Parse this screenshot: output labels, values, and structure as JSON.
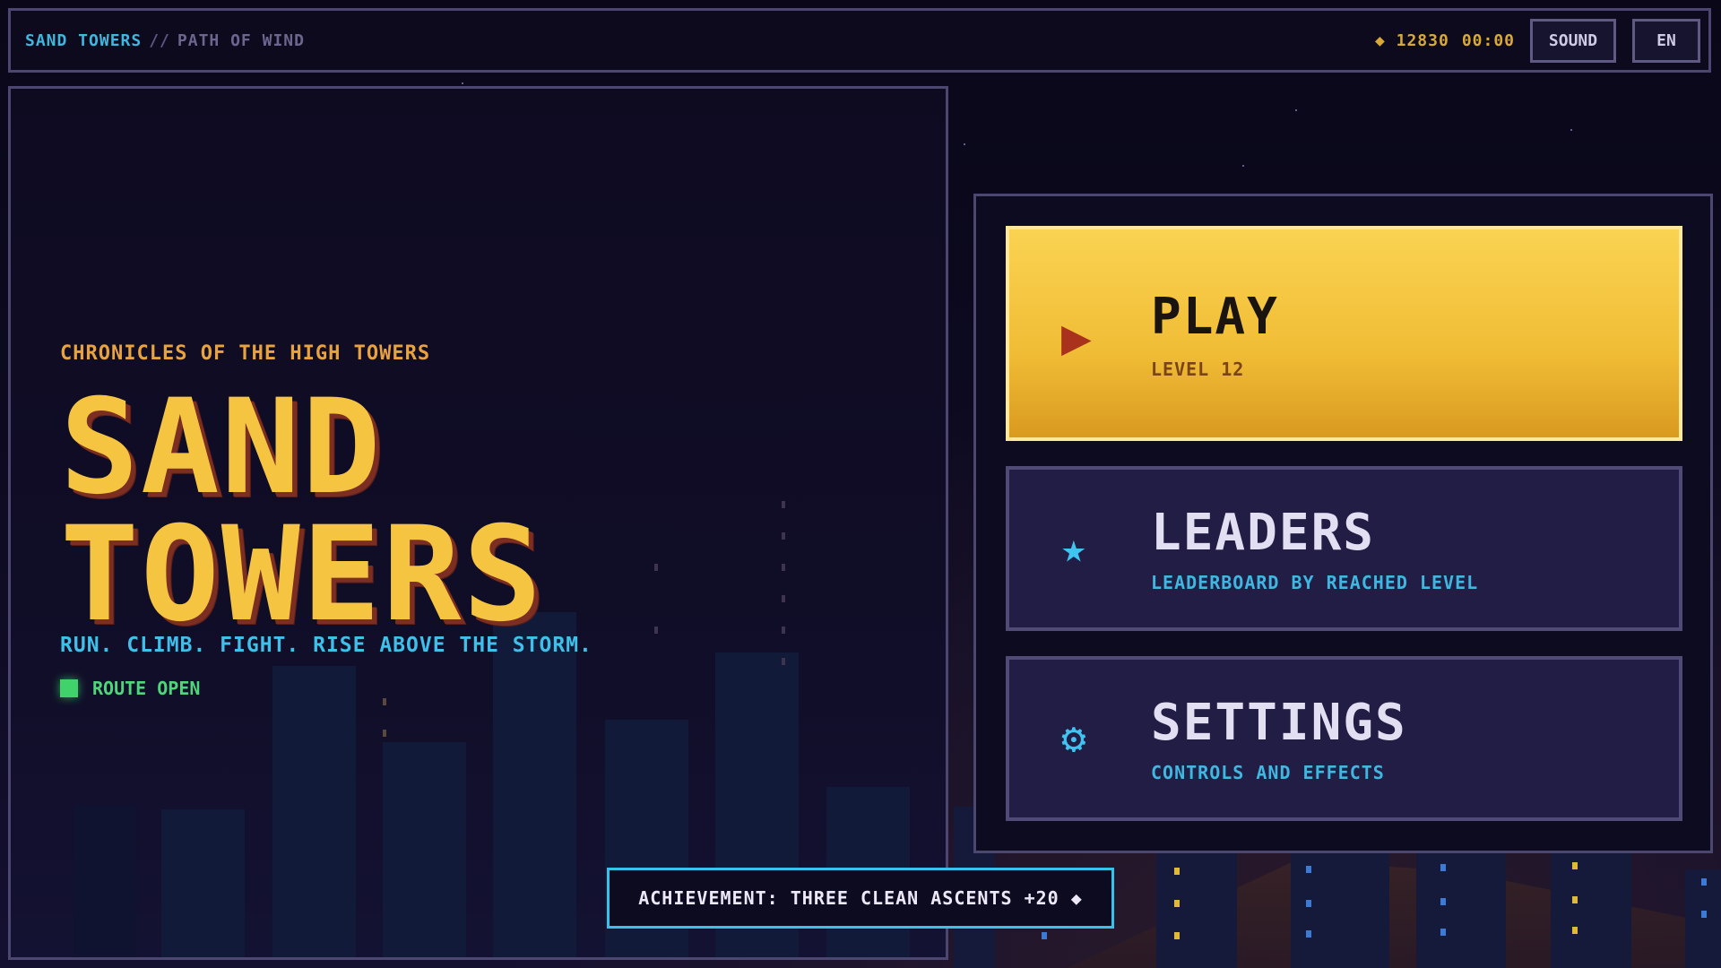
{
  "topbar": {
    "game_name": "SAND TOWERS",
    "separator": "//",
    "subtitle": "PATH OF WIND",
    "coins": "◆ 12830",
    "timer": "00:00",
    "sound_label": "SOUND",
    "language_label": "EN"
  },
  "hero": {
    "eyebrow": "CHRONICLES OF THE HIGH TOWERS",
    "title_line1": "SAND",
    "title_line2": "TOWERS",
    "tagline": "RUN. CLIMB. FIGHT. RISE ABOVE THE STORM.",
    "status": "ROUTE OPEN"
  },
  "menu": {
    "play": {
      "label": "PLAY",
      "sub": "LEVEL 12",
      "icon": "▶",
      "icon_name": "play-triangle-icon"
    },
    "leaders": {
      "label": "LEADERS",
      "sub": "LEADERBOARD BY REACHED LEVEL",
      "icon": "★",
      "icon_name": "star-icon"
    },
    "settings": {
      "label": "SETTINGS",
      "sub": "CONTROLS AND EFFECTS",
      "icon": "⚙",
      "icon_name": "gear-icon"
    }
  },
  "toast": {
    "text": "ACHIEVEMENT: THREE CLEAN ASCENTS +20 ◆"
  },
  "colors": {
    "accent_gold": "#f5c542",
    "accent_cyan": "#3fb7e0",
    "status_green": "#41d36b",
    "background": "#0d0a1e"
  }
}
